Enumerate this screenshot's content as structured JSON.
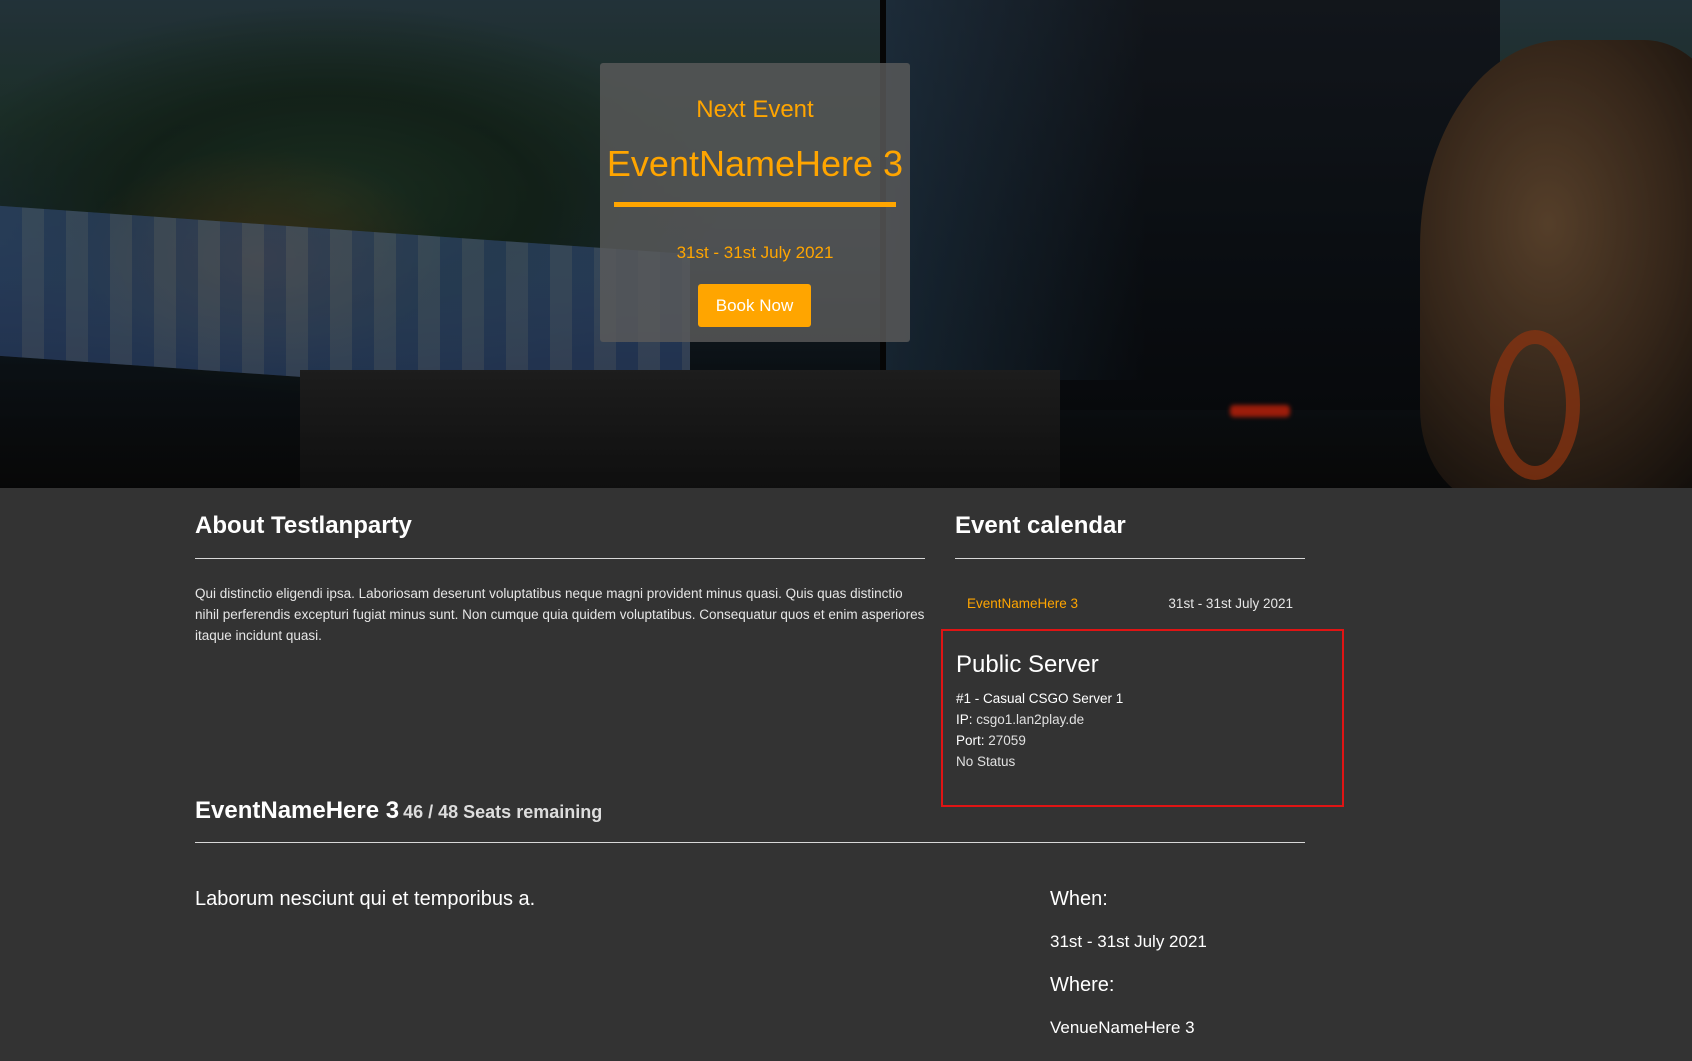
{
  "hero": {
    "kicker": "Next Event",
    "event_title": "EventNameHere 3",
    "dates": "31st - 31st July 2021",
    "book_label": "Book Now"
  },
  "about": {
    "heading": "About Testlanparty",
    "text": "Qui distinctio eligendi ipsa. Laboriosam deserunt voluptatibus neque magni provident minus quasi. Quis quas distinctio nihil perferendis excepturi fugiat minus sunt. Non cumque quia quidem voluptatibus. Consequatur quos et enim asperiores itaque incidunt quasi."
  },
  "calendar": {
    "heading": "Event calendar",
    "items": [
      {
        "name": "EventNameHere 3",
        "dates": "31st - 31st July 2021"
      }
    ]
  },
  "server": {
    "heading": "Public Server",
    "name": "#1 - Casual CSGO Server 1",
    "ip_label": "IP:",
    "ip_value": "csgo1.lan2play.de",
    "port_label": "Port:",
    "port_value": "27059",
    "status": "No Status"
  },
  "event": {
    "name": "EventNameHere 3",
    "seats": "46 / 48 Seats remaining",
    "description": "Laborum nesciunt qui et temporibus a.",
    "when_label": "When:",
    "when_value": "31st - 31st July 2021",
    "where_label": "Where:",
    "where_value": "VenueNameHere 3"
  },
  "colors": {
    "accent": "#ffa500",
    "background": "#333333",
    "highlight_border": "#e01414"
  }
}
